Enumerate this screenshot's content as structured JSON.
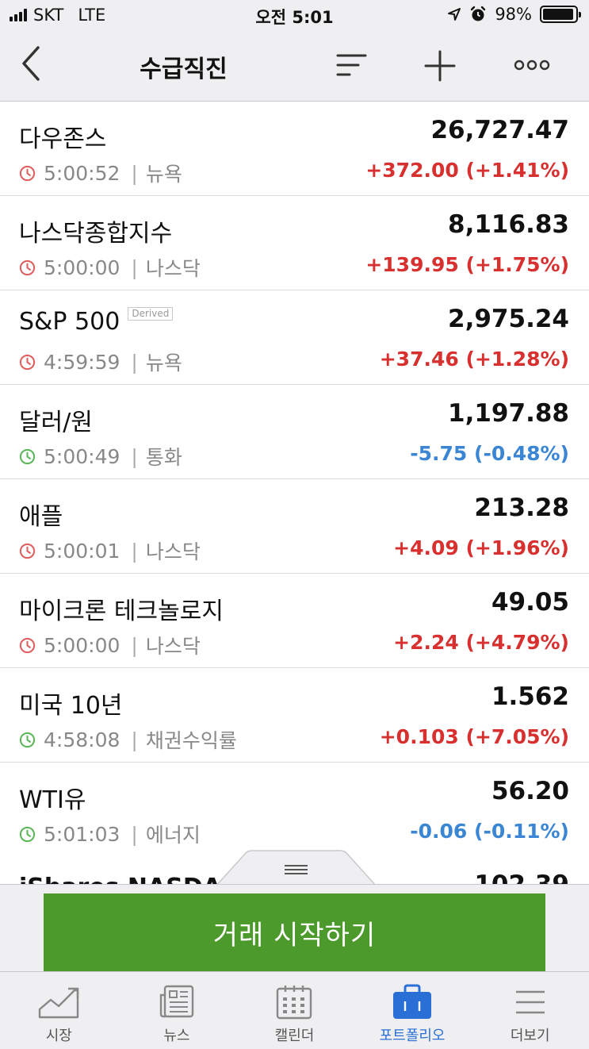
{
  "status_bar": {
    "carrier": "SKT",
    "network": "LTE",
    "time": "오전 5:01",
    "battery": "98%"
  },
  "header": {
    "title": "수급직진",
    "icons": [
      "back-chevron-icon",
      "sort-icon",
      "plus-icon",
      "more-icon"
    ]
  },
  "quotes": [
    {
      "name": "다우존스",
      "price": "26,727.47",
      "time": "5:00:52",
      "exchange": "뉴욕",
      "change": "+372.00 (+1.41%)",
      "direction": "up",
      "market_open": false
    },
    {
      "name": "나스닥종합지수",
      "price": "8,116.83",
      "time": "5:00:00",
      "exchange": "나스닥",
      "change": "+139.95 (+1.75%)",
      "direction": "up",
      "market_open": false
    },
    {
      "name": "S&P 500",
      "badge": "Derived",
      "price": "2,975.24",
      "time": "4:59:59",
      "exchange": "뉴욕",
      "change": "+37.46 (+1.28%)",
      "direction": "up",
      "market_open": false
    },
    {
      "name": "달러/원",
      "price": "1,197.88",
      "time": "5:00:49",
      "exchange": "통화",
      "change": "-5.75 (-0.48%)",
      "direction": "down",
      "market_open": true
    },
    {
      "name": "애플",
      "price": "213.28",
      "time": "5:00:01",
      "exchange": "나스닥",
      "change": "+4.09 (+1.96%)",
      "direction": "up",
      "market_open": false
    },
    {
      "name": "마이크론 테크놀로지",
      "price": "49.05",
      "time": "5:00:00",
      "exchange": "나스닥",
      "change": "+2.24 (+4.79%)",
      "direction": "up",
      "market_open": false
    },
    {
      "name": "미국 10년",
      "price": "1.562",
      "time": "4:58:08",
      "exchange": "채권수익률",
      "change": "+0.103 (+7.05%)",
      "direction": "up",
      "market_open": true
    },
    {
      "name": "WTI유",
      "price": "56.20",
      "time": "5:01:03",
      "exchange": "에너지",
      "change": "-0.06 (-0.11%)",
      "direction": "down",
      "market_open": true
    }
  ],
  "trade": {
    "button_label": "거래 시작하기"
  },
  "tabs": [
    {
      "label": "시장",
      "icon": "market-chart-icon",
      "active": false
    },
    {
      "label": "뉴스",
      "icon": "news-icon",
      "active": false
    },
    {
      "label": "캘린더",
      "icon": "calendar-icon",
      "active": false
    },
    {
      "label": "포트폴리오",
      "icon": "portfolio-briefcase-icon",
      "active": true
    },
    {
      "label": "더보기",
      "icon": "menu-icon",
      "active": false
    }
  ],
  "colors": {
    "up": "#d8302f",
    "down": "#3b86d4",
    "clock_closed": "#e06060",
    "clock_open": "#5db85c",
    "accent": "#2a6fd6",
    "trade_button": "#4b9a2b"
  }
}
